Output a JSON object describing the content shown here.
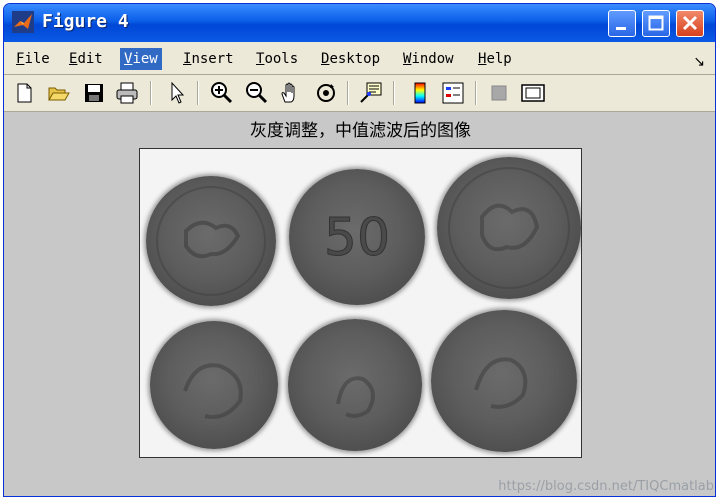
{
  "window": {
    "title": "Figure 4",
    "controls": {
      "minimize": "minimize",
      "maximize": "maximize",
      "close": "close"
    }
  },
  "menu": {
    "items": [
      {
        "hot": "F",
        "rest": "ile"
      },
      {
        "hot": "E",
        "rest": "dit"
      },
      {
        "hot": "V",
        "rest": "iew",
        "active": true
      },
      {
        "hot": "I",
        "rest": "nsert"
      },
      {
        "hot": "T",
        "rest": "ools"
      },
      {
        "hot": "D",
        "rest": "esktop"
      },
      {
        "hot": "W",
        "rest": "indow"
      },
      {
        "hot": "H",
        "rest": "elp"
      }
    ],
    "dock_glyph": "↘"
  },
  "toolbar": {
    "buttons": [
      "new-figure-icon",
      "open-file-icon",
      "save-icon",
      "print-icon",
      "pointer-icon",
      "zoom-in-icon",
      "zoom-out-icon",
      "pan-hand-icon",
      "rotate-3d-icon",
      "data-cursor-icon",
      "colorbar-icon",
      "legend-icon",
      "hide-plot-tools-icon",
      "show-plot-tools-icon"
    ]
  },
  "figure": {
    "title": "灰度调整，中值滤波后的图像",
    "coins": [
      {
        "label": ""
      },
      {
        "label": "50"
      },
      {
        "label": ""
      },
      {
        "label": ""
      },
      {
        "label": ""
      },
      {
        "label": ""
      }
    ]
  },
  "watermark": "https://blog.csdn.net/TIQCmatlab",
  "colors": {
    "titlebar": "#0a5ee8",
    "menu_active": "#316ac5",
    "figure_bg": "#c8c8c8",
    "close_button": "#d8401c"
  }
}
